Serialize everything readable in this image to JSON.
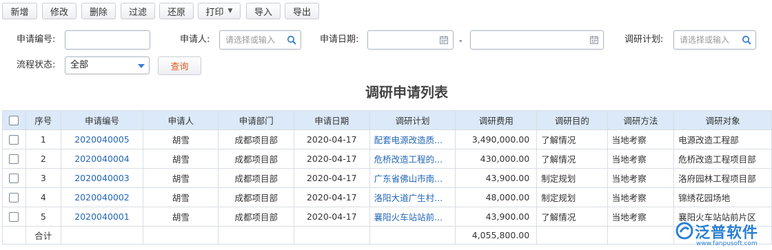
{
  "toolbar": {
    "buttons": [
      {
        "label": "新增"
      },
      {
        "label": "修改"
      },
      {
        "label": "删除"
      },
      {
        "label": "过滤"
      },
      {
        "label": "还原"
      },
      {
        "label": "打印"
      },
      {
        "label": "导入"
      },
      {
        "label": "导出"
      }
    ]
  },
  "filters": {
    "app_no_label": "申请编号:",
    "applicant_label": "申请人:",
    "applicant_placeholder": "请选择或输入",
    "date_label": "申请日期:",
    "date_sep": "-",
    "plan_label": "调研计划:",
    "plan_placeholder": "请选择或输入",
    "status_label": "流程状态:",
    "status_value": "全部",
    "query_label": "查询"
  },
  "table": {
    "title": "调研申请列表",
    "columns": [
      "序号",
      "申请编号",
      "申请人",
      "申请部门",
      "申请日期",
      "调研计划",
      "调研费用",
      "调研目的",
      "调研方法",
      "调研对象"
    ],
    "rows": [
      {
        "no": "1",
        "code": "2020040005",
        "applicant": "胡雪",
        "dept": "成都项目部",
        "date": "2020-04-17",
        "plan": "配套电源改造质...",
        "cost": "3,490,000.00",
        "purpose": "了解情况",
        "method": "当地考察",
        "target": "电源改造工程部"
      },
      {
        "no": "2",
        "code": "2020040004",
        "applicant": "胡雪",
        "dept": "成都项目部",
        "date": "2020-04-17",
        "plan": "危桥改造工程的...",
        "cost": "430,000.00",
        "purpose": "了解情况",
        "method": "当地考察",
        "target": "危桥改造工程项目部"
      },
      {
        "no": "3",
        "code": "2020040003",
        "applicant": "胡雪",
        "dept": "成都项目部",
        "date": "2020-04-17",
        "plan": "广东省佛山市南...",
        "cost": "43,900.00",
        "purpose": "制定规划",
        "method": "当地考察",
        "target": "洛府园林工程项目部"
      },
      {
        "no": "4",
        "code": "2020040002",
        "applicant": "胡雪",
        "dept": "成都项目部",
        "date": "2020-04-17",
        "plan": "洛阳大道广生村...",
        "cost": "48,000.00",
        "purpose": "制定规划",
        "method": "当地考察",
        "target": "锦绣花园场地"
      },
      {
        "no": "5",
        "code": "2020040001",
        "applicant": "胡雪",
        "dept": "成都项目部",
        "date": "2020-04-17",
        "plan": "襄阳火车站站前...",
        "cost": "43,900.00",
        "purpose": "了解情况",
        "method": "当地考察",
        "target": "襄阳火车站站前片区"
      }
    ],
    "total_label": "合计",
    "total_cost": "4,055,800.00"
  },
  "logo": {
    "name": "泛普软件",
    "url": "www.fanpusoft.com"
  },
  "colors": {
    "header_bg": "#dbe9f8",
    "link": "#2266b8",
    "query_text": "#e35a1c",
    "accent": "#3b7fd1"
  }
}
